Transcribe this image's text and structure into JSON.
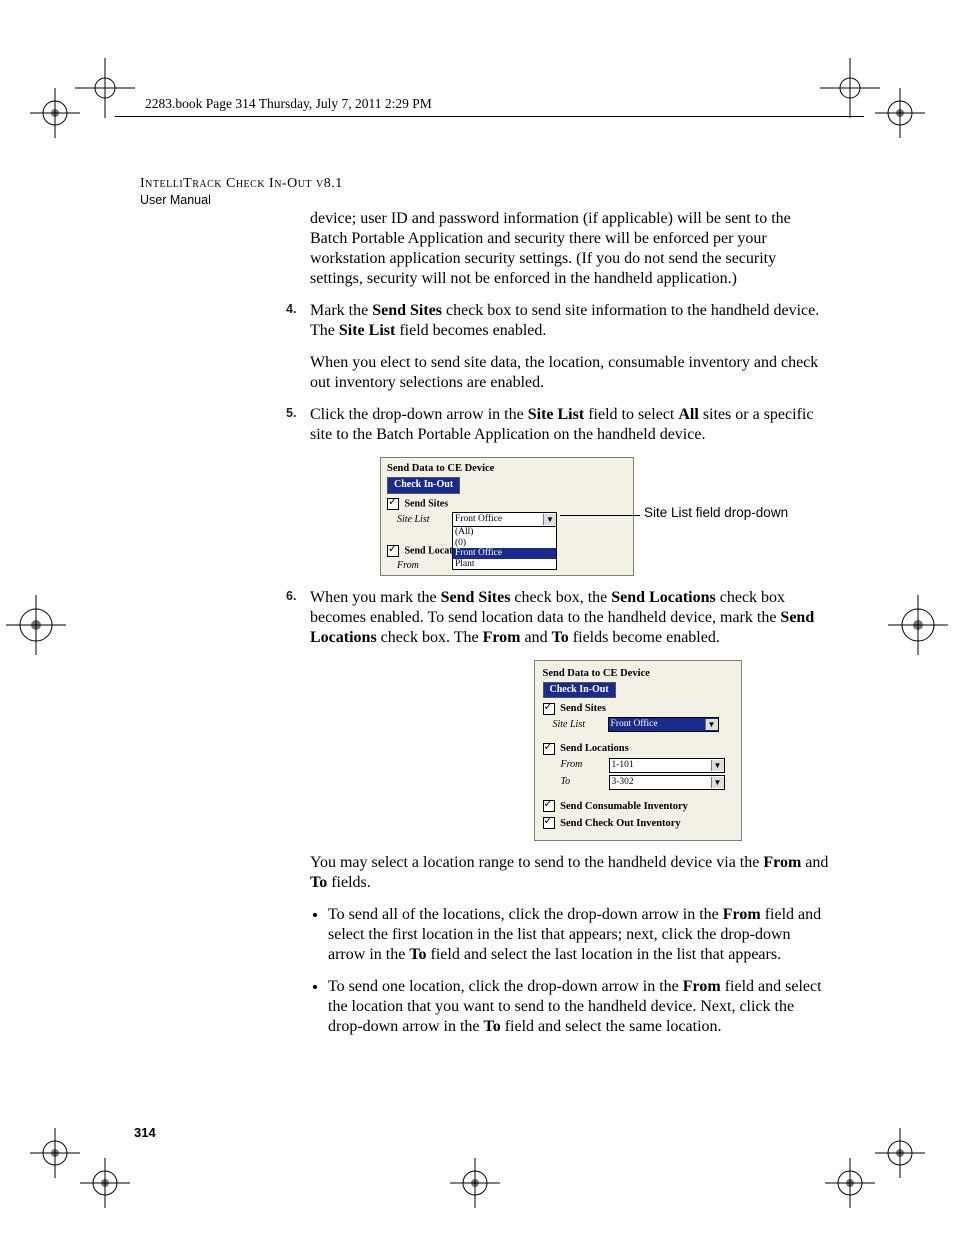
{
  "header_line": "2283.book  Page 314  Thursday, July 7, 2011  2:29 PM",
  "running_head_title": "IntelliTrack Check In-Out v8.1",
  "running_head_sub": "User Manual",
  "page_number": "314",
  "intro_para": "device; user ID and password information (if applicable) will be sent to the Batch Portable Application and security there will be enforced per your workstation application security settings. (If you do not send the security settings, security will not be enforced in the handheld application.)",
  "steps": {
    "s4": {
      "num": "4.",
      "p1a": "Mark the ",
      "p1b": "Send Sites",
      "p1c": " check box to send site information to the handheld device. The ",
      "p1d": "Site List",
      "p1e": " field becomes enabled.",
      "p2": "When you elect to send site data, the location, consumable inventory and check out inventory selections are enabled."
    },
    "s5": {
      "num": "5.",
      "p1a": "Click the drop-down arrow in the ",
      "p1b": "Site List",
      "p1c": " field to select ",
      "p1d": "All",
      "p1e": " sites or a specific site to the Batch Portable Application on the handheld device."
    },
    "s6": {
      "num": "6.",
      "p1a": "When you mark the ",
      "p1b": "Send Sites",
      "p1c": " check box, the ",
      "p1d": "Send Locations",
      "p1e": " check box becomes enabled. To send location data to the handheld device, mark the ",
      "p1f": "Send Locations",
      "p1g": " check box. The ",
      "p1h": "From",
      "p1i": " and ",
      "p1j": "To",
      "p1k": " fields become enabled."
    }
  },
  "fig1": {
    "title": "Send Data to CE Device",
    "tab": "Check In-Out",
    "cb1": "Send Sites",
    "site_list_lbl": "Site List",
    "site_list_val": "Front Office",
    "opt_all": "(All)",
    "opt_blank": "(0)",
    "opt_front": "Front Office",
    "opt_plant": "Plant",
    "cb2": "Send Location",
    "from_lbl": "From",
    "callout": "Site List field drop-down"
  },
  "fig2": {
    "title": "Send Data to CE Device",
    "tab": "Check In-Out",
    "cb_sites": "Send Sites",
    "site_list_lbl": "Site List",
    "site_list_val": "Front Office",
    "cb_loc": "Send Locations",
    "from_lbl": "From",
    "from_val": "1-101",
    "to_lbl": "To",
    "to_val": "3-302",
    "cb_cons": "Send Consumable Inventory",
    "cb_chkout": "Send Check Out Inventory"
  },
  "after_fig2_a": "You may select a location range to send to the handheld device via the ",
  "after_fig2_b": "From",
  "after_fig2_c": " and ",
  "after_fig2_d": "To",
  "after_fig2_e": " fields.",
  "bullets": {
    "b1a": "To send all of the locations, click the drop-down arrow in the ",
    "b1b": "From",
    "b1c": " field and select the first location in the list that appears; next, click the drop-down arrow in the ",
    "b1d": "To",
    "b1e": " field and select the last location in the list that appears.",
    "b2a": "To send one location, click the drop-down arrow in the ",
    "b2b": "From",
    "b2c": " field and select the location that you want to send to the handheld device. Next, click the drop-down arrow in the ",
    "b2d": "To",
    "b2e": " field and select the same location."
  }
}
